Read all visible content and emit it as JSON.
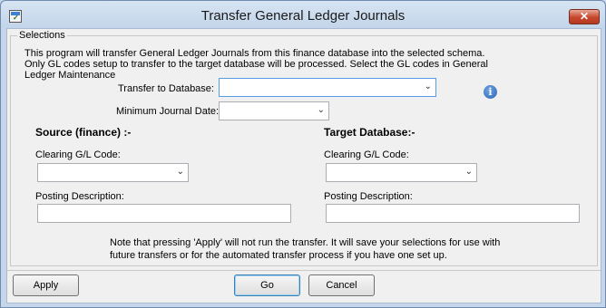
{
  "window": {
    "title": "Transfer General Ledger Journals"
  },
  "selections": {
    "legend": "Selections",
    "description": "This program will transfer General Ledger Journals from this finance database into the selected schema.  Only GL codes setup to transfer to the target database will be processed.  Select the GL codes in General Ledger Maintenance",
    "transfer_to_database": {
      "label": "Transfer to Database:",
      "value": ""
    },
    "minimum_journal_date": {
      "label": "Minimum Journal Date:",
      "value": ""
    },
    "info_icon": "info-icon"
  },
  "source": {
    "heading": "Source (finance) :-",
    "clearing_label": "Clearing G/L Code:",
    "clearing_value": "",
    "posting_label": "Posting Description:",
    "posting_value": ""
  },
  "target": {
    "heading": "Target Database:-",
    "clearing_label": "Clearing G/L Code:",
    "clearing_value": "",
    "posting_label": "Posting Description:",
    "posting_value": ""
  },
  "note": "Note that pressing 'Apply' will not run the transfer.  It will save your selections for use with future transfers or for the automated transfer process if you have one set up.",
  "buttons": {
    "apply": "Apply",
    "go": "Go",
    "cancel": "Cancel"
  }
}
